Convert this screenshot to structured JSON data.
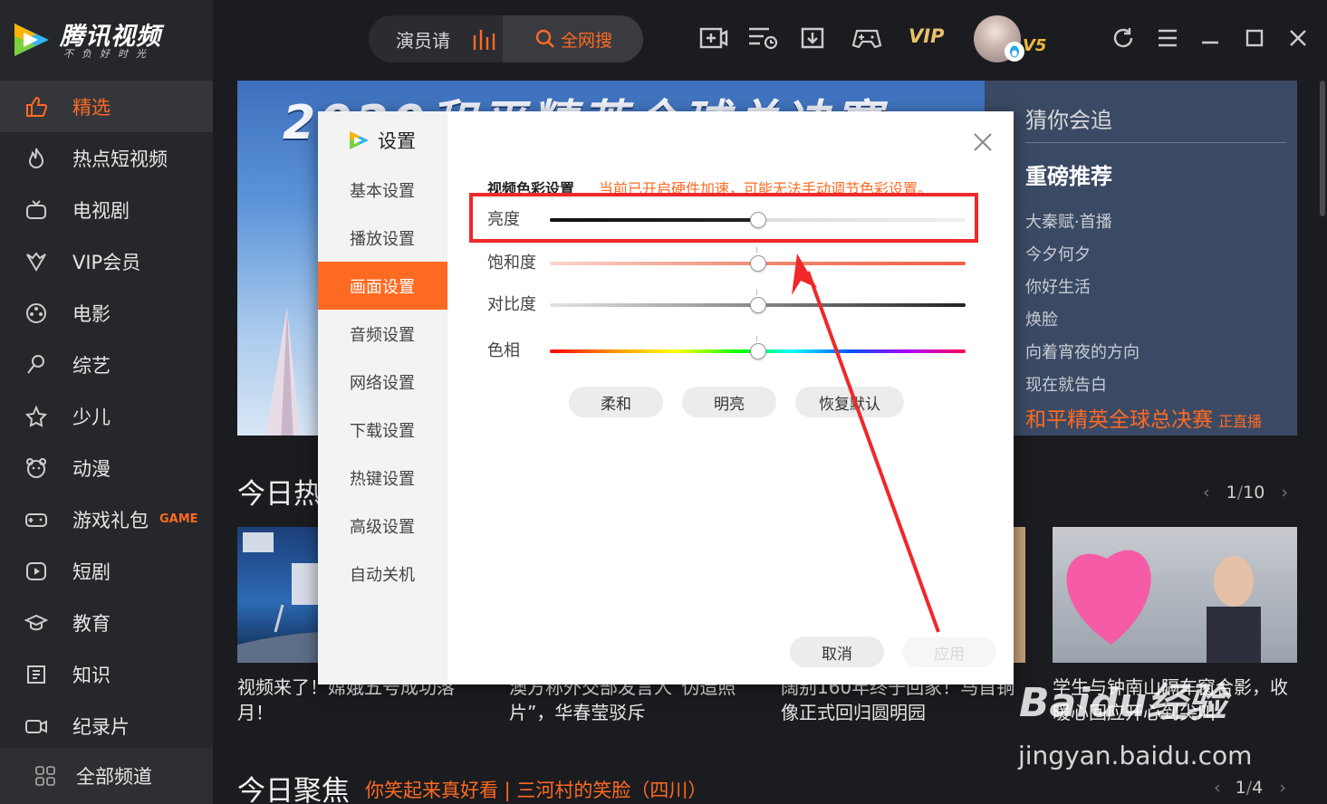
{
  "brand": {
    "title": "腾讯视频",
    "slogan": "不负好时光"
  },
  "sidebar": {
    "items": [
      {
        "label": "精选",
        "icon": "thumbs-up-icon",
        "active": true
      },
      {
        "label": "热点短视频",
        "icon": "flame-icon"
      },
      {
        "label": "电视剧",
        "icon": "tv-icon"
      },
      {
        "label": "VIP会员",
        "icon": "vip-diamond-icon"
      },
      {
        "label": "电影",
        "icon": "film-reel-icon"
      },
      {
        "label": "综艺",
        "icon": "microphone-icon"
      },
      {
        "label": "少儿",
        "icon": "star-kid-icon"
      },
      {
        "label": "动漫",
        "icon": "bear-face-icon"
      },
      {
        "label": "游戏礼包",
        "icon": "gamepad-icon",
        "badge": "GAME"
      },
      {
        "label": "短剧",
        "icon": "play-square-icon"
      },
      {
        "label": "教育",
        "icon": "graduation-cap-icon"
      },
      {
        "label": "知识",
        "icon": "book-icon"
      },
      {
        "label": "纪录片",
        "icon": "camera-icon"
      }
    ],
    "all_channels": "全部频道"
  },
  "topbar": {
    "search_placeholder": "演员请",
    "search_button": "全网搜",
    "vip_label": "VIP",
    "level_badge": "V5"
  },
  "banner": {
    "headline": "2020和平精英全球总决赛"
  },
  "recommend_panel": {
    "title": "猜你会追",
    "subtitle": "重磅推荐",
    "items": [
      "大秦赋·首播",
      "今夕何夕",
      "你好生活",
      "焕脸",
      "向着宵夜的方向",
      "现在就告白"
    ],
    "live_text": "和平精英全球总决赛",
    "live_tag": "正直播"
  },
  "today_hot": {
    "title": "今日热",
    "pager": {
      "current": "1",
      "total": "10"
    },
    "captions": [
      "视频来了！嫦娥五号成功落月！",
      "澳方称外交部发言人“伪造照片”，华春莹驳斥",
      "阔别160年终于回家！马首铜像正式回归圆明园",
      "学生与钟南山隔车窗合影，收暖心回应开心到尖叫"
    ]
  },
  "today_focus": {
    "title": "今日聚焦",
    "link": "你笑起来真好看 | 三河村的笑脸（四川）",
    "pager": {
      "current": "1",
      "total": "4"
    }
  },
  "settings": {
    "title": "设置",
    "menu": [
      "基本设置",
      "播放设置",
      "画面设置",
      "音频设置",
      "网络设置",
      "下载设置",
      "热键设置",
      "高级设置",
      "自动关机"
    ],
    "active_menu": "画面设置",
    "section_title": "视频色彩设置",
    "warning": "当前已开启硬件加速，可能无法手动调节色彩设置。",
    "sliders": [
      {
        "label": "亮度",
        "value": 0.5
      },
      {
        "label": "饱和度",
        "value": 0.5
      },
      {
        "label": "对比度",
        "value": 0.5
      },
      {
        "label": "色相",
        "value": 0.5
      }
    ],
    "presets": [
      "柔和",
      "明亮",
      "恢复默认"
    ],
    "cancel": "取消",
    "apply": "应用"
  },
  "watermark": {
    "brand": "Baidu经验",
    "url": "jingyan.baidu.com"
  },
  "colors": {
    "accent": "#ff6a22",
    "annotation": "#f0282a",
    "sidebar": "#26272b",
    "background": "#1b1c20"
  }
}
